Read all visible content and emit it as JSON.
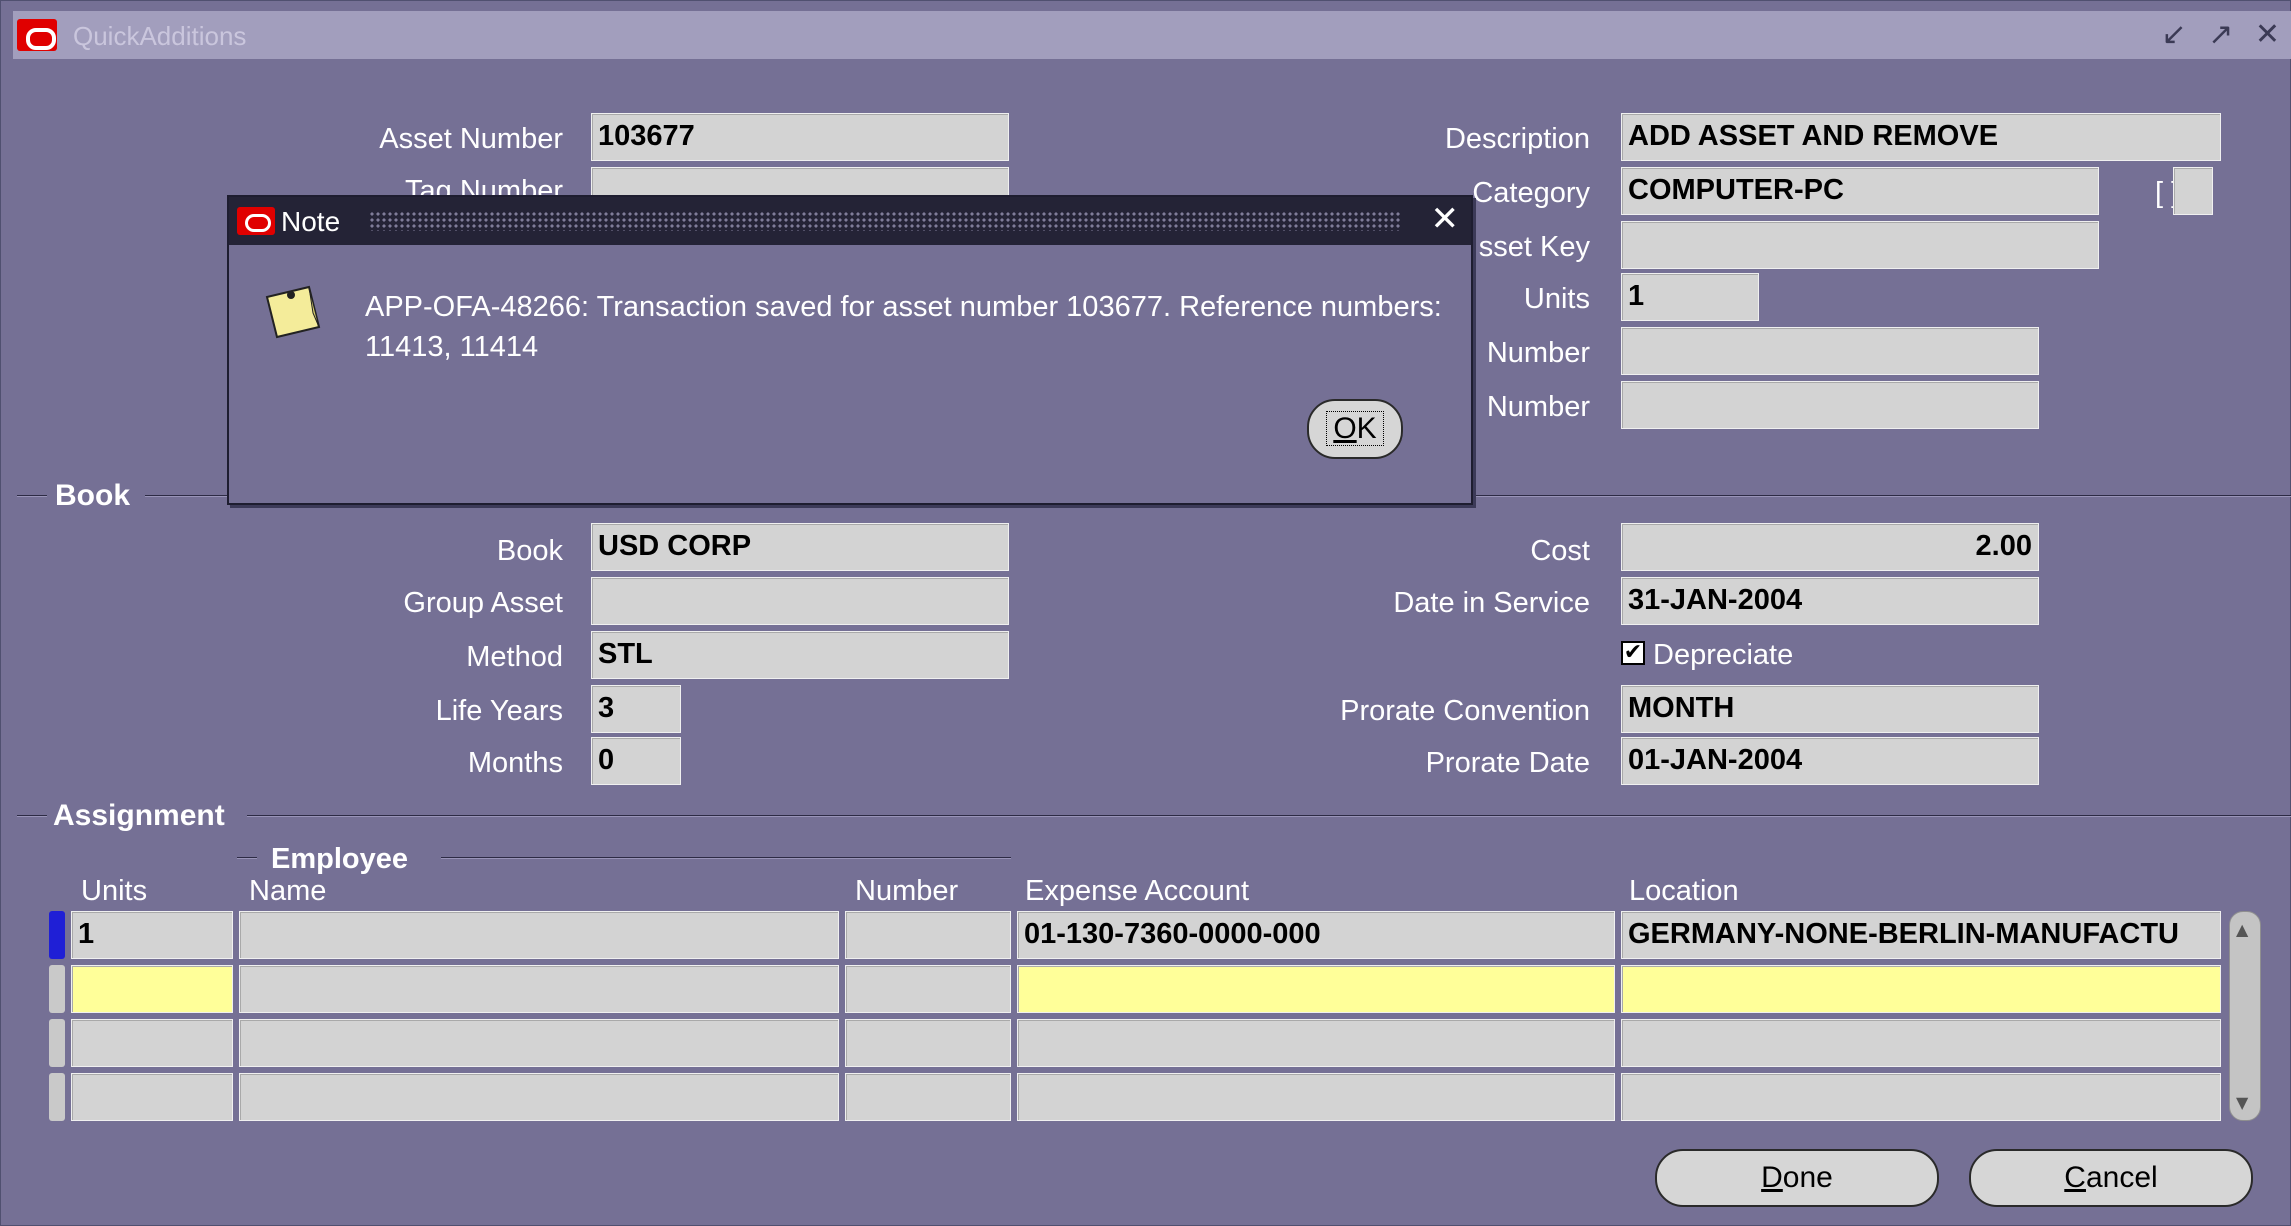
{
  "window": {
    "title": "QuickAdditions",
    "controls": "↙ ↗ ✕"
  },
  "header": {
    "asset_number_label": "Asset Number",
    "asset_number": "103677",
    "tag_number_label": "Tag Number",
    "tag_number": "",
    "description_label": "Description",
    "description": "ADD ASSET AND REMOVE",
    "category_label": "Category",
    "category": "COMPUTER-PC",
    "asset_key_label": "sset Key",
    "asset_key": "",
    "units_label": "Units",
    "units": "1",
    "number1_label": "Number",
    "number1": "",
    "number2_label": "Number",
    "number2": "",
    "bracket": "[ ]"
  },
  "book_section": {
    "title": "Book",
    "book_label": "Book",
    "book": "USD CORP",
    "group_asset_label": "Group Asset",
    "group_asset": "",
    "method_label": "Method",
    "method": "STL",
    "life_years_label": "Life Years",
    "life_years": "3",
    "months_label": "Months",
    "months": "0",
    "cost_label": "Cost",
    "cost": "2.00",
    "date_in_service_label": "Date in Service",
    "date_in_service": "31-JAN-2004",
    "depreciate_label": "Depreciate",
    "depreciate_checked": true,
    "prorate_convention_label": "Prorate Convention",
    "prorate_convention": "MONTH",
    "prorate_date_label": "Prorate Date",
    "prorate_date": "01-JAN-2004"
  },
  "assignment": {
    "title": "Assignment",
    "employee_group": "Employee",
    "columns": {
      "units": "Units",
      "name": "Name",
      "number": "Number",
      "expense_account": "Expense Account",
      "location": "Location"
    },
    "rows": [
      {
        "units": "1",
        "name": "",
        "number": "",
        "expense_account": "01-130-7360-0000-000",
        "location": "GERMANY-NONE-BERLIN-MANUFACTU"
      },
      {
        "units": "",
        "name": "",
        "number": "",
        "expense_account": "",
        "location": ""
      },
      {
        "units": "",
        "name": "",
        "number": "",
        "expense_account": "",
        "location": ""
      },
      {
        "units": "",
        "name": "",
        "number": "",
        "expense_account": "",
        "location": ""
      }
    ]
  },
  "buttons": {
    "done": "Done",
    "cancel": "Cancel"
  },
  "dialog": {
    "title": "Note",
    "message": "APP-OFA-48266: Transaction saved for asset number 103677.  Reference numbers:  11413, 11414",
    "ok": "OK",
    "close": "✕"
  },
  "colors": {
    "window_bg": "#757095",
    "field_bg": "#d3d3d3",
    "current_row": "#ffff99",
    "brand_red": "#e00000"
  }
}
